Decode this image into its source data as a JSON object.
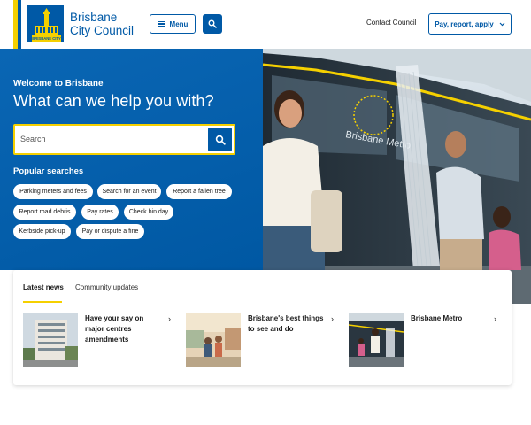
{
  "header": {
    "logo_line1": "Brisbane",
    "logo_line2": "City Council",
    "logo_badge": "BRISBANE CITY",
    "menu_label": "Menu",
    "contact_label": "Contact Council",
    "pay_label": "Pay, report, apply"
  },
  "hero": {
    "welcome": "Welcome to Brisbane",
    "title": "What can we help you with?",
    "search_placeholder": "Search",
    "popular_title": "Popular searches",
    "bus_text": "Brisbane Metro",
    "chips": [
      "Parking meters and fees",
      "Search for an event",
      "Report a fallen tree",
      "Report road debris",
      "Pay rates",
      "Check bin day",
      "Kerbside pick-up",
      "Pay or dispute a fine"
    ]
  },
  "news": {
    "tabs": [
      "Latest news",
      "Community updates"
    ],
    "items": [
      {
        "title": "Have your say on major centres amendments"
      },
      {
        "title": "Brisbane's best things to see and do"
      },
      {
        "title": "Brisbane Metro"
      }
    ]
  },
  "colors": {
    "brand_blue": "#0059a6",
    "accent_yellow": "#f5d000"
  }
}
